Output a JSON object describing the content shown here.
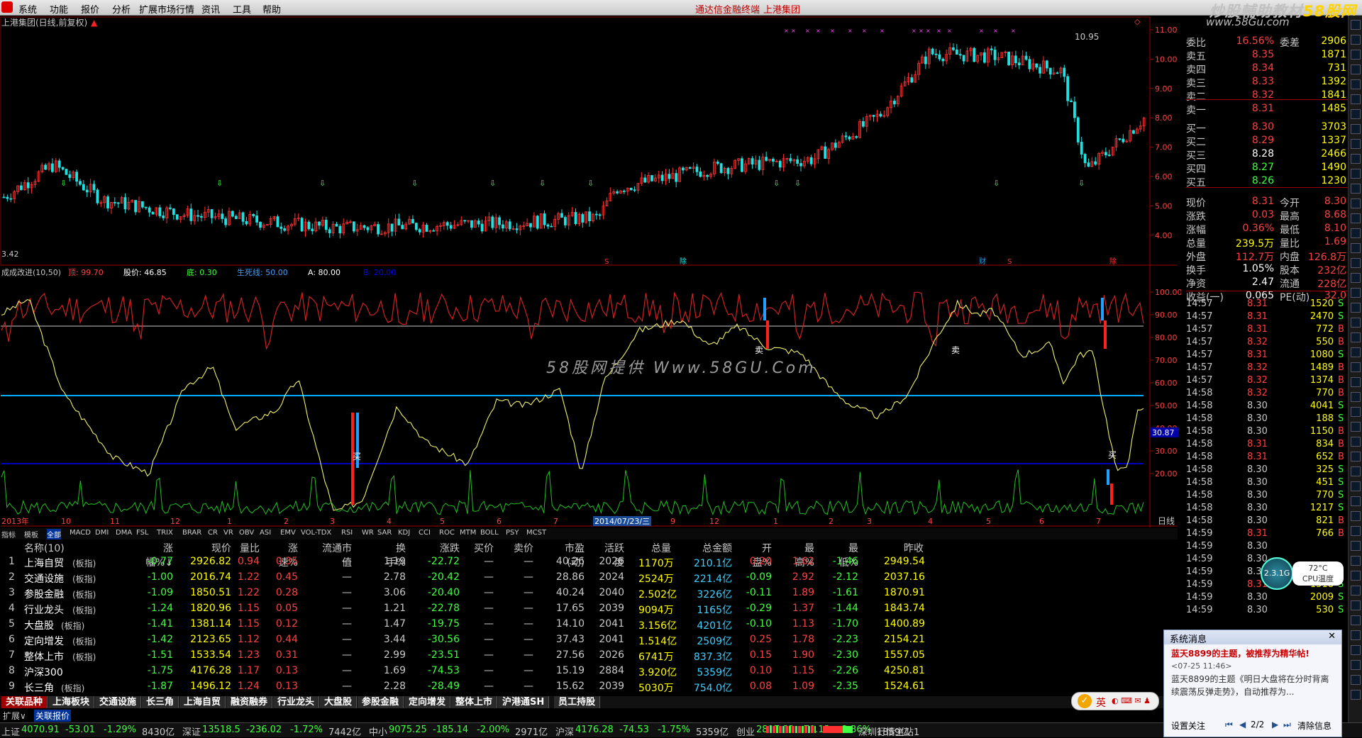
{
  "menu": {
    "items": [
      "系统",
      "功能",
      "报价",
      "分析",
      "扩展市场行情",
      "资讯",
      "工具",
      "帮助"
    ],
    "center_title": "通达信金融终端",
    "center_stock": "上港集团",
    "brand": {
      "text1": "炒股輔助教材",
      "text2": "58股网"
    },
    "brand_url": "www.58Gu.com"
  },
  "chart": {
    "main_title": "上港集团(日线,前复权)",
    "high_label": "10.95",
    "low_label": "3.42",
    "price_axis": [
      "11.00",
      "10.00",
      "9.00",
      "8.00",
      "7.00",
      "6.00",
      "5.00",
      "4.00"
    ],
    "event_marks": [
      "S",
      "除",
      "财",
      "S",
      "除"
    ],
    "indicator_title": "成成改进(10,50)",
    "indicator_params": [
      {
        "label": "顶: ",
        "value": "99.70",
        "color": "#ff4040"
      },
      {
        "label": "股价: ",
        "value": "46.85",
        "color": "#ffffff"
      },
      {
        "label": "底: ",
        "value": "0.30",
        "color": "#40ff40"
      },
      {
        "label": "生死线: ",
        "value": "50.00",
        "color": "#40a0ff"
      },
      {
        "label": "A: ",
        "value": "80.00",
        "color": "#ffffff"
      },
      {
        "label": "B: ",
        "value": "20.00",
        "color": "#0000ff"
      }
    ],
    "ind_axis": [
      "100.00",
      "90.00",
      "80.00",
      "70.00",
      "60.00",
      "50.00",
      "40.00",
      "30.00",
      "20.00"
    ],
    "ind_current": "30.87",
    "buy_label": "买",
    "sell_label": "卖",
    "watermark": "58股网提供 Www.58GU.Com",
    "time_axis": [
      "2013年",
      "10",
      "11",
      "12",
      "1",
      "2",
      "3",
      "4",
      "5",
      "6",
      "7",
      "2014/07/23/三",
      "9",
      "12",
      "1",
      "2",
      "3",
      "4",
      "5",
      "6",
      "7"
    ],
    "period": "日线"
  },
  "indicator_tabs": [
    "指标",
    "模板",
    "全部",
    "MACD",
    "DMI",
    "DMA",
    "FSL",
    "TRIX",
    "BRAR",
    "CR",
    "VR",
    "OBV",
    "ASI",
    "EMV",
    "VOL-TDX",
    "RSI",
    "WR",
    "SAR",
    "KDJ",
    "CCI",
    "ROC",
    "MTM",
    "BOLL",
    "PSY",
    "MCST"
  ],
  "quote": {
    "rows": [
      {
        "l": "委比",
        "v": "16.56%",
        "l2": "委差",
        "v2": "2906",
        "c": "#ff4040"
      },
      {
        "l": "卖五",
        "v": "8.35",
        "l2": "",
        "v2": "1871",
        "c": "#ff4040"
      },
      {
        "l": "卖四",
        "v": "8.34",
        "l2": "",
        "v2": "731",
        "c": "#ff4040"
      },
      {
        "l": "卖三",
        "v": "8.33",
        "l2": "",
        "v2": "1392",
        "c": "#ff4040"
      },
      {
        "l": "卖二",
        "v": "8.32",
        "l2": "",
        "v2": "1841",
        "c": "#ff4040"
      },
      {
        "l": "卖一",
        "v": "8.31",
        "l2": "",
        "v2": "1485",
        "c": "#ff4040"
      },
      {
        "l": "买一",
        "v": "8.30",
        "l2": "",
        "v2": "3703",
        "c": "#ff4040"
      },
      {
        "l": "买二",
        "v": "8.29",
        "l2": "",
        "v2": "1337",
        "c": "#ff4040"
      },
      {
        "l": "买三",
        "v": "8.28",
        "l2": "",
        "v2": "2466",
        "c": "#ffffff"
      },
      {
        "l": "买四",
        "v": "8.27",
        "l2": "",
        "v2": "1490",
        "c": "#40ff40"
      },
      {
        "l": "买五",
        "v": "8.26",
        "l2": "",
        "v2": "1230",
        "c": "#40ff40"
      },
      {
        "l": "现价",
        "v": "8.31",
        "l2": "今开",
        "v2": "8.30",
        "c": "#ff4040"
      },
      {
        "l": "涨跌",
        "v": "0.03",
        "l2": "最高",
        "v2": "8.68",
        "c": "#ff4040"
      },
      {
        "l": "涨幅",
        "v": "0.36%",
        "l2": "最低",
        "v2": "8.10",
        "c": "#ff4040"
      },
      {
        "l": "总量",
        "v": "239.5万",
        "l2": "量比",
        "v2": "1.69",
        "c": "#ffff00"
      },
      {
        "l": "外盘",
        "v": "112.7万",
        "l2": "内盘",
        "v2": "126.8万",
        "c": "#ff4040"
      },
      {
        "l": "换手",
        "v": "1.05%",
        "l2": "股本",
        "v2": "232亿",
        "c": "#ffffff"
      },
      {
        "l": "净资",
        "v": "2.47",
        "l2": "流通",
        "v2": "228亿",
        "c": "#ffffff"
      },
      {
        "l": "收益(一)",
        "v": "0.065",
        "l2": "PE(动)",
        "v2": "32.0",
        "c": "#ffffff"
      }
    ]
  },
  "ticks": [
    {
      "t": "14:57",
      "p": "8.31",
      "v": "1520",
      "s": "S"
    },
    {
      "t": "14:57",
      "p": "8.31",
      "v": "2470",
      "s": "S"
    },
    {
      "t": "14:57",
      "p": "8.31",
      "v": "772",
      "s": "B"
    },
    {
      "t": "14:57",
      "p": "8.32",
      "v": "550",
      "s": "B"
    },
    {
      "t": "14:57",
      "p": "8.31",
      "v": "1080",
      "s": "S"
    },
    {
      "t": "14:57",
      "p": "8.32",
      "v": "1489",
      "s": "B"
    },
    {
      "t": "14:57",
      "p": "8.32",
      "v": "1374",
      "s": "B"
    },
    {
      "t": "14:58",
      "p": "8.32",
      "v": "770",
      "s": "B"
    },
    {
      "t": "14:58",
      "p": "8.30",
      "v": "4041",
      "s": "S"
    },
    {
      "t": "14:58",
      "p": "8.30",
      "v": "188",
      "s": "S"
    },
    {
      "t": "14:58",
      "p": "8.30",
      "v": "1150",
      "s": "B"
    },
    {
      "t": "14:58",
      "p": "8.31",
      "v": "834",
      "s": "B"
    },
    {
      "t": "14:58",
      "p": "8.31",
      "v": "652",
      "s": "B"
    },
    {
      "t": "14:58",
      "p": "8.30",
      "v": "325",
      "s": "S"
    },
    {
      "t": "14:58",
      "p": "8.30",
      "v": "451",
      "s": "S"
    },
    {
      "t": "14:58",
      "p": "8.30",
      "v": "770",
      "s": "S"
    },
    {
      "t": "14:58",
      "p": "8.30",
      "v": "1217",
      "s": "S"
    },
    {
      "t": "14:58",
      "p": "8.30",
      "v": "821",
      "s": "B"
    },
    {
      "t": "14:59",
      "p": "8.31",
      "v": "766",
      "s": "B"
    },
    {
      "t": "14:59",
      "p": "8.30",
      "v": "",
      "s": ""
    },
    {
      "t": "14:59",
      "p": "8.30",
      "v": "",
      "s": ""
    },
    {
      "t": "14:59",
      "p": "8.30",
      "v": "",
      "s": ""
    },
    {
      "t": "14:59",
      "p": "8.31",
      "v": "1518",
      "s": "S"
    },
    {
      "t": "14:59",
      "p": "8.30",
      "v": "2009",
      "s": "S"
    },
    {
      "t": "14:59",
      "p": "8.30",
      "v": "530",
      "s": "S"
    }
  ],
  "table": {
    "headers": [
      "名称(10)",
      "涨幅%↓",
      "现价",
      "量比",
      "涨速%",
      "流通市值",
      "换手%",
      "涨跌",
      "买价",
      "卖价",
      "市盈(动)",
      "活跃度",
      "总量",
      "总金额",
      "开盘%",
      "最高%",
      "最低%",
      "昨收"
    ],
    "rows": [
      [
        "上海自贸",
        "-0.77",
        "2926.82",
        "0.94",
        "0.35",
        "—",
        "1.19",
        "-22.72",
        "—",
        "—",
        "40.26",
        "2026",
        "1170万",
        "210.1亿",
        "0.20",
        "1.62",
        "-1.46",
        "2949.54"
      ],
      [
        "交通设施",
        "-1.00",
        "2016.74",
        "1.22",
        "0.45",
        "—",
        "2.78",
        "-20.42",
        "—",
        "—",
        "28.86",
        "2024",
        "2524万",
        "221.4亿",
        "-0.09",
        "2.92",
        "-2.12",
        "2037.16"
      ],
      [
        "参股金融",
        "-1.09",
        "1850.51",
        "1.22",
        "0.28",
        "—",
        "3.06",
        "-20.40",
        "—",
        "—",
        "40.24",
        "2040",
        "2.502亿",
        "3226亿",
        "-0.11",
        "1.89",
        "-1.61",
        "1870.91"
      ],
      [
        "行业龙头",
        "-1.24",
        "1820.96",
        "1.15",
        "0.05",
        "—",
        "1.21",
        "-22.78",
        "—",
        "—",
        "17.65",
        "2039",
        "9094万",
        "1165亿",
        "-0.29",
        "1.37",
        "-1.44",
        "1843.74"
      ],
      [
        "大盘股",
        "-1.41",
        "1381.14",
        "1.15",
        "0.12",
        "—",
        "1.47",
        "-19.75",
        "—",
        "—",
        "14.10",
        "2041",
        "3.156亿",
        "4201亿",
        "-0.10",
        "1.13",
        "-1.70",
        "1400.89"
      ],
      [
        "定向增发",
        "-1.42",
        "2123.65",
        "1.12",
        "0.44",
        "—",
        "3.44",
        "-30.56",
        "—",
        "—",
        "37.43",
        "2041",
        "1.514亿",
        "2509亿",
        "0.25",
        "1.78",
        "-2.23",
        "2154.21"
      ],
      [
        "整体上市",
        "-1.51",
        "1533.54",
        "1.23",
        "0.31",
        "—",
        "2.99",
        "-23.51",
        "—",
        "—",
        "27.56",
        "2026",
        "6741万",
        "837.3亿",
        "0.15",
        "1.90",
        "-2.30",
        "1557.05"
      ],
      [
        "沪深300",
        "-1.75",
        "4176.28",
        "1.17",
        "0.13",
        "—",
        "1.69",
        "-74.53",
        "—",
        "—",
        "15.19",
        "2884",
        "3.920亿",
        "5359亿",
        "0.10",
        "1.15",
        "-2.26",
        "4250.81"
      ],
      [
        "长三角",
        "-1.87",
        "1496.12",
        "1.24",
        "0.13",
        "—",
        "2.28",
        "-28.49",
        "—",
        "—",
        "15.62",
        "2039",
        "5030万",
        "754.0亿",
        "0.08",
        "1.09",
        "-2.35",
        "1524.61"
      ]
    ],
    "name_suffix": "(板指)"
  },
  "bottom_tabs": [
    "关联品种",
    "上海板块",
    "交通设施",
    "长三角",
    "上海自贸",
    "融资融券",
    "行业龙头",
    "大盘股",
    "参股金融",
    "定向增发",
    "整体上市",
    "沪港通SH",
    "员工持股"
  ],
  "expand": [
    "扩展∨",
    "关联报价"
  ],
  "status": {
    "items": [
      {
        "name": "上证",
        "val": "4070.91",
        "chg": "-53.01",
        "pct": "-1.29%",
        "amt": "8430亿"
      },
      {
        "name": "深证",
        "val": "13518.5",
        "chg": "-236.02",
        "pct": "-1.72%",
        "amt": "7442亿"
      },
      {
        "name": "中小",
        "val": "9075.25",
        "chg": "-185.14",
        "pct": "-2.00%",
        "amt": "2971亿"
      },
      {
        "name": "沪深",
        "val": "4176.28",
        "chg": "-74.53",
        "pct": "-1.75%",
        "amt": "5359亿"
      },
      {
        "name": "创业",
        "val": "2897.82",
        "chg": "-70.13",
        "pct": "-2.36%",
        "amt": "1859亿"
      }
    ],
    "server": "深圳行情主站1"
  },
  "popup": {
    "title": "系统消息",
    "headline": "蓝天8899的主题，被推荐为精华帖!",
    "time": "07-25 11:46",
    "body1": "蓝天8899的主题《明日大盘将在分时背离",
    "body2": "续震荡反弹走势》，自动推荐为...",
    "settings": "设置关注",
    "page": "2/2",
    "clear": "清除信息"
  },
  "gauge": {
    "value": "2.3.1G",
    "temp": "72°C",
    "label": "CPU温度"
  },
  "ime": "英"
}
